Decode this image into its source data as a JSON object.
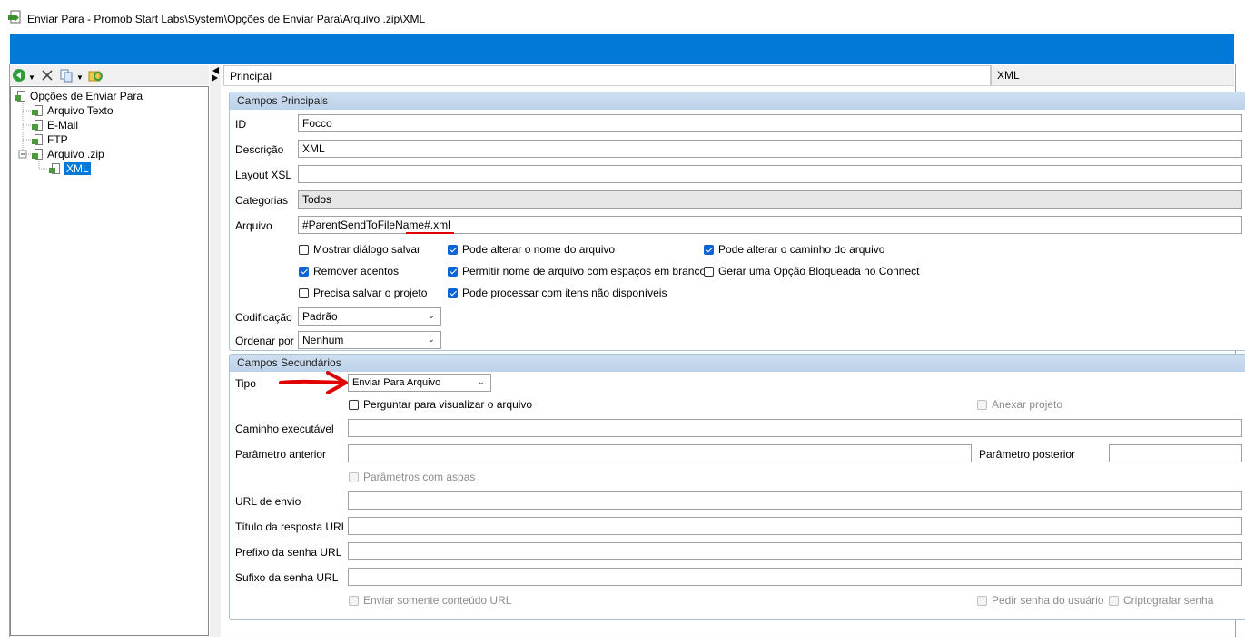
{
  "window": {
    "title": "Enviar Para - Promob Start Labs\\System\\Opções de Enviar Para\\Arquivo .zip\\XML"
  },
  "colors": {
    "accent_bar": "#0278d7",
    "group_header": "#c6d9ee",
    "selection": "#0078d7",
    "annotation": "#e00000"
  },
  "left_toolbar": {
    "icons": [
      "back-icon",
      "close-icon",
      "copy-icon",
      "refresh-icon"
    ]
  },
  "tree": {
    "root": "Opções de Enviar Para",
    "items": [
      "Arquivo Texto",
      "E-Mail",
      "FTP",
      "Arquivo .zip"
    ],
    "child": "XML"
  },
  "tabs": {
    "main": "Principal",
    "xml": "XML"
  },
  "principal": {
    "title": "Campos Principais",
    "id_label": "ID",
    "id_value": "Focco",
    "desc_label": "Descrição",
    "desc_value": "XML",
    "layout_label": "Layout XSL",
    "layout_value": "",
    "cat_label": "Categorias",
    "cat_value": "Todos",
    "file_label": "Arquivo",
    "file_value_a": "#ParentSendToFileName#",
    "file_value_b": ".xml",
    "cb_show_dialog": "Mostrar diálogo salvar",
    "cb_rename": "Pode alterar o nome do arquivo",
    "cb_change_path": "Pode alterar o caminho do arquivo",
    "cb_remove_accents": "Remover acentos",
    "cb_spaces": "Permitir nome de arquivo com espaços em branco",
    "cb_locked_option": "Gerar uma Opção Bloqueada no Connect",
    "cb_save_project": "Precisa salvar o projeto",
    "cb_unavailable": "Pode processar com itens não disponíveis",
    "enc_label": "Codificação",
    "enc_value": "Padrão",
    "order_label": "Ordenar por",
    "order_value": "Nenhum"
  },
  "secondary": {
    "title": "Campos Secundários",
    "tipo_label": "Tipo",
    "tipo_value": "Enviar Para Arquivo",
    "cb_preview": "Perguntar para visualizar o arquivo",
    "cb_attach": "Anexar projeto",
    "exe_label": "Caminho executável",
    "param_before_label": "Parâmetro anterior",
    "param_after_label": "Parâmetro posterior",
    "cb_quoted": "Parâmetros com aspas",
    "url_label": "URL de envio",
    "url_title_label": "Título da resposta URL",
    "pwd_prefix_label": "Prefixo da senha URL",
    "pwd_suffix_label": "Sufixo da senha URL",
    "cb_url_only": "Enviar somente conteúdo URL",
    "cb_ask_pwd": "Pedir senha do usuário",
    "cb_encrypt": "Criptografar senha"
  }
}
